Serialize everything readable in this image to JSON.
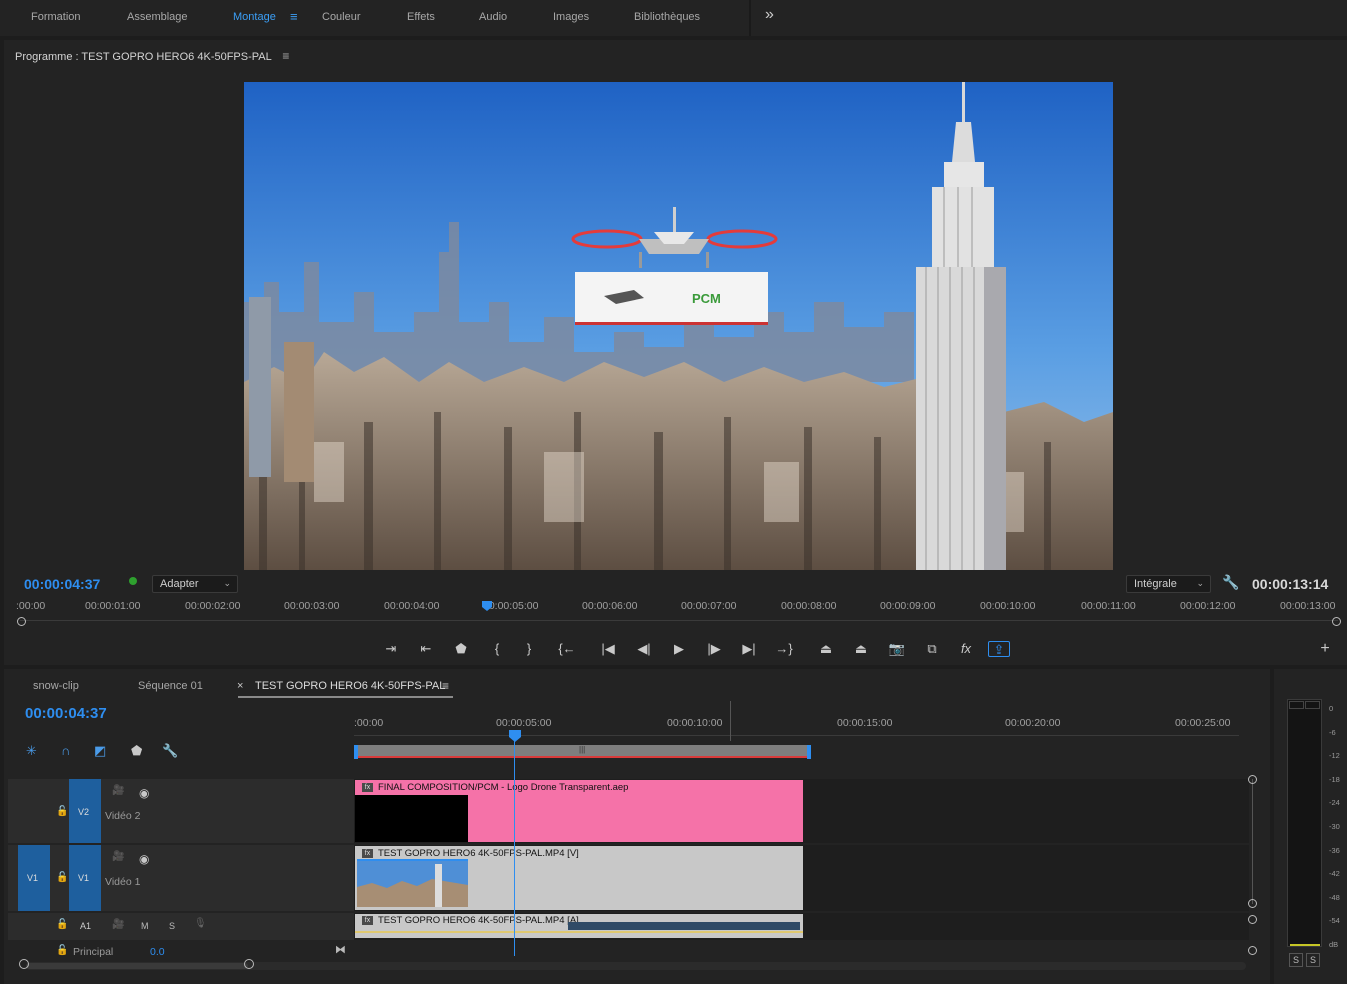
{
  "workspaces": [
    {
      "label": "Formation",
      "active": false
    },
    {
      "label": "Assemblage",
      "active": false
    },
    {
      "label": "Montage",
      "active": true
    },
    {
      "label": "Couleur",
      "active": false
    },
    {
      "label": "Effets",
      "active": false
    },
    {
      "label": "Audio",
      "active": false
    },
    {
      "label": "Images",
      "active": false
    },
    {
      "label": "Bibliothèques",
      "active": false
    }
  ],
  "overflow_glyph": "»",
  "program": {
    "title": "Programme : TEST GOPRO HERO6 4K-50FPS-PAL",
    "menu_glyph": "≡",
    "current_tc": "00:00:04:37",
    "fit_label": "Adapter",
    "quality_label": "Intégrale",
    "duration_tc": "00:00:13:14",
    "ruler": [
      ":00:00",
      "00:00:01:00",
      "00:00:02:00",
      "00:00:03:00",
      "00:00:04:00",
      "00:00:05:00",
      "00:00:06:00",
      "00:00:07:00",
      "00:00:08:00",
      "00:00:09:00",
      "00:00:10:00",
      "00:00:11:00",
      "00:00:12:00",
      "00:00:13:00"
    ],
    "billboard_logo": "PCM"
  },
  "timeline": {
    "tabs": [
      {
        "label": "snow-clip",
        "active": false
      },
      {
        "label": "Séquence 01",
        "active": false
      },
      {
        "label": "TEST GOPRO HERO6 4K-50FPS-PAL",
        "active": true
      }
    ],
    "close_glyph": "×",
    "menu_glyph": "≡",
    "current_tc": "00:00:04:37",
    "ruler": [
      ":00:00",
      "00:00:05:00",
      "00:00:10:00",
      "00:00:15:00",
      "00:00:20:00",
      "00:00:25:00"
    ],
    "tracks": {
      "v2": {
        "target": "V2",
        "name": "Vidéo 2"
      },
      "v1": {
        "source": "V1",
        "target": "V1",
        "name": "Vidéo 1"
      },
      "a1": {
        "target": "A1",
        "mute": "M",
        "solo": "S"
      },
      "master": {
        "name": "Principal",
        "value": "0.0"
      }
    },
    "clips": {
      "v2": "FINAL COMPOSITION/PCM - Logo Drone Transparent.aep",
      "v1": "TEST GOPRO HERO6 4K-50FPS-PAL.MP4 [V]",
      "a1": "TEST GOPRO HERO6 4K-50FPS-PAL.MP4 [A]"
    },
    "fx_badge": "fx"
  },
  "meter": {
    "scale": [
      "0",
      "-6",
      "-12",
      "-18",
      "-24",
      "-30",
      "-36",
      "-42",
      "-48",
      "-54",
      "dB"
    ],
    "solo_left": "S",
    "solo_right": "S"
  },
  "colors": {
    "accent": "#2e8ef0",
    "clip_pink": "#f572a8",
    "clip_gray": "#c8c8c8"
  }
}
